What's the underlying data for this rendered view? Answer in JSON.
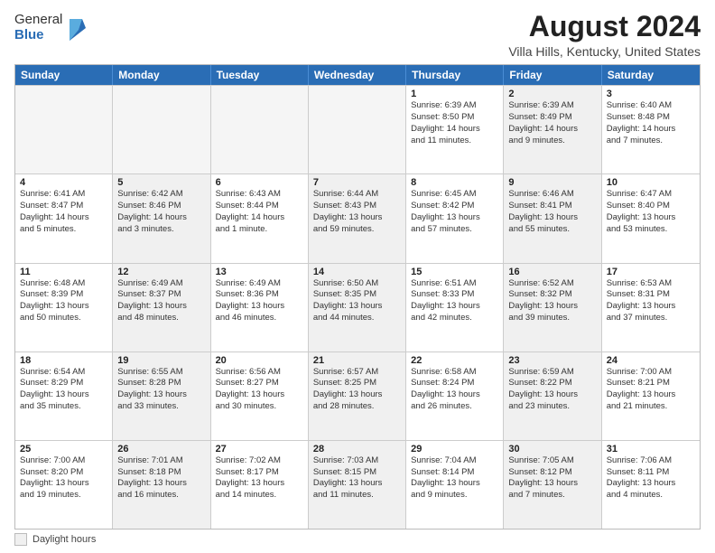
{
  "logo": {
    "general": "General",
    "blue": "Blue"
  },
  "title": "August 2024",
  "subtitle": "Villa Hills, Kentucky, United States",
  "headers": [
    "Sunday",
    "Monday",
    "Tuesday",
    "Wednesday",
    "Thursday",
    "Friday",
    "Saturday"
  ],
  "legend": {
    "box_label": "Daylight hours"
  },
  "weeks": [
    [
      {
        "day": "",
        "lines": [],
        "empty": true
      },
      {
        "day": "",
        "lines": [],
        "empty": true
      },
      {
        "day": "",
        "lines": [],
        "empty": true
      },
      {
        "day": "",
        "lines": [],
        "empty": true
      },
      {
        "day": "1",
        "lines": [
          "Sunrise: 6:39 AM",
          "Sunset: 8:50 PM",
          "Daylight: 14 hours",
          "and 11 minutes."
        ],
        "shaded": false
      },
      {
        "day": "2",
        "lines": [
          "Sunrise: 6:39 AM",
          "Sunset: 8:49 PM",
          "Daylight: 14 hours",
          "and 9 minutes."
        ],
        "shaded": true
      },
      {
        "day": "3",
        "lines": [
          "Sunrise: 6:40 AM",
          "Sunset: 8:48 PM",
          "Daylight: 14 hours",
          "and 7 minutes."
        ],
        "shaded": false
      }
    ],
    [
      {
        "day": "4",
        "lines": [
          "Sunrise: 6:41 AM",
          "Sunset: 8:47 PM",
          "Daylight: 14 hours",
          "and 5 minutes."
        ],
        "shaded": false
      },
      {
        "day": "5",
        "lines": [
          "Sunrise: 6:42 AM",
          "Sunset: 8:46 PM",
          "Daylight: 14 hours",
          "and 3 minutes."
        ],
        "shaded": true
      },
      {
        "day": "6",
        "lines": [
          "Sunrise: 6:43 AM",
          "Sunset: 8:44 PM",
          "Daylight: 14 hours",
          "and 1 minute."
        ],
        "shaded": false
      },
      {
        "day": "7",
        "lines": [
          "Sunrise: 6:44 AM",
          "Sunset: 8:43 PM",
          "Daylight: 13 hours",
          "and 59 minutes."
        ],
        "shaded": true
      },
      {
        "day": "8",
        "lines": [
          "Sunrise: 6:45 AM",
          "Sunset: 8:42 PM",
          "Daylight: 13 hours",
          "and 57 minutes."
        ],
        "shaded": false
      },
      {
        "day": "9",
        "lines": [
          "Sunrise: 6:46 AM",
          "Sunset: 8:41 PM",
          "Daylight: 13 hours",
          "and 55 minutes."
        ],
        "shaded": true
      },
      {
        "day": "10",
        "lines": [
          "Sunrise: 6:47 AM",
          "Sunset: 8:40 PM",
          "Daylight: 13 hours",
          "and 53 minutes."
        ],
        "shaded": false
      }
    ],
    [
      {
        "day": "11",
        "lines": [
          "Sunrise: 6:48 AM",
          "Sunset: 8:39 PM",
          "Daylight: 13 hours",
          "and 50 minutes."
        ],
        "shaded": false
      },
      {
        "day": "12",
        "lines": [
          "Sunrise: 6:49 AM",
          "Sunset: 8:37 PM",
          "Daylight: 13 hours",
          "and 48 minutes."
        ],
        "shaded": true
      },
      {
        "day": "13",
        "lines": [
          "Sunrise: 6:49 AM",
          "Sunset: 8:36 PM",
          "Daylight: 13 hours",
          "and 46 minutes."
        ],
        "shaded": false
      },
      {
        "day": "14",
        "lines": [
          "Sunrise: 6:50 AM",
          "Sunset: 8:35 PM",
          "Daylight: 13 hours",
          "and 44 minutes."
        ],
        "shaded": true
      },
      {
        "day": "15",
        "lines": [
          "Sunrise: 6:51 AM",
          "Sunset: 8:33 PM",
          "Daylight: 13 hours",
          "and 42 minutes."
        ],
        "shaded": false
      },
      {
        "day": "16",
        "lines": [
          "Sunrise: 6:52 AM",
          "Sunset: 8:32 PM",
          "Daylight: 13 hours",
          "and 39 minutes."
        ],
        "shaded": true
      },
      {
        "day": "17",
        "lines": [
          "Sunrise: 6:53 AM",
          "Sunset: 8:31 PM",
          "Daylight: 13 hours",
          "and 37 minutes."
        ],
        "shaded": false
      }
    ],
    [
      {
        "day": "18",
        "lines": [
          "Sunrise: 6:54 AM",
          "Sunset: 8:29 PM",
          "Daylight: 13 hours",
          "and 35 minutes."
        ],
        "shaded": false
      },
      {
        "day": "19",
        "lines": [
          "Sunrise: 6:55 AM",
          "Sunset: 8:28 PM",
          "Daylight: 13 hours",
          "and 33 minutes."
        ],
        "shaded": true
      },
      {
        "day": "20",
        "lines": [
          "Sunrise: 6:56 AM",
          "Sunset: 8:27 PM",
          "Daylight: 13 hours",
          "and 30 minutes."
        ],
        "shaded": false
      },
      {
        "day": "21",
        "lines": [
          "Sunrise: 6:57 AM",
          "Sunset: 8:25 PM",
          "Daylight: 13 hours",
          "and 28 minutes."
        ],
        "shaded": true
      },
      {
        "day": "22",
        "lines": [
          "Sunrise: 6:58 AM",
          "Sunset: 8:24 PM",
          "Daylight: 13 hours",
          "and 26 minutes."
        ],
        "shaded": false
      },
      {
        "day": "23",
        "lines": [
          "Sunrise: 6:59 AM",
          "Sunset: 8:22 PM",
          "Daylight: 13 hours",
          "and 23 minutes."
        ],
        "shaded": true
      },
      {
        "day": "24",
        "lines": [
          "Sunrise: 7:00 AM",
          "Sunset: 8:21 PM",
          "Daylight: 13 hours",
          "and 21 minutes."
        ],
        "shaded": false
      }
    ],
    [
      {
        "day": "25",
        "lines": [
          "Sunrise: 7:00 AM",
          "Sunset: 8:20 PM",
          "Daylight: 13 hours",
          "and 19 minutes."
        ],
        "shaded": false
      },
      {
        "day": "26",
        "lines": [
          "Sunrise: 7:01 AM",
          "Sunset: 8:18 PM",
          "Daylight: 13 hours",
          "and 16 minutes."
        ],
        "shaded": true
      },
      {
        "day": "27",
        "lines": [
          "Sunrise: 7:02 AM",
          "Sunset: 8:17 PM",
          "Daylight: 13 hours",
          "and 14 minutes."
        ],
        "shaded": false
      },
      {
        "day": "28",
        "lines": [
          "Sunrise: 7:03 AM",
          "Sunset: 8:15 PM",
          "Daylight: 13 hours",
          "and 11 minutes."
        ],
        "shaded": true
      },
      {
        "day": "29",
        "lines": [
          "Sunrise: 7:04 AM",
          "Sunset: 8:14 PM",
          "Daylight: 13 hours",
          "and 9 minutes."
        ],
        "shaded": false
      },
      {
        "day": "30",
        "lines": [
          "Sunrise: 7:05 AM",
          "Sunset: 8:12 PM",
          "Daylight: 13 hours",
          "and 7 minutes."
        ],
        "shaded": true
      },
      {
        "day": "31",
        "lines": [
          "Sunrise: 7:06 AM",
          "Sunset: 8:11 PM",
          "Daylight: 13 hours",
          "and 4 minutes."
        ],
        "shaded": false
      }
    ]
  ]
}
